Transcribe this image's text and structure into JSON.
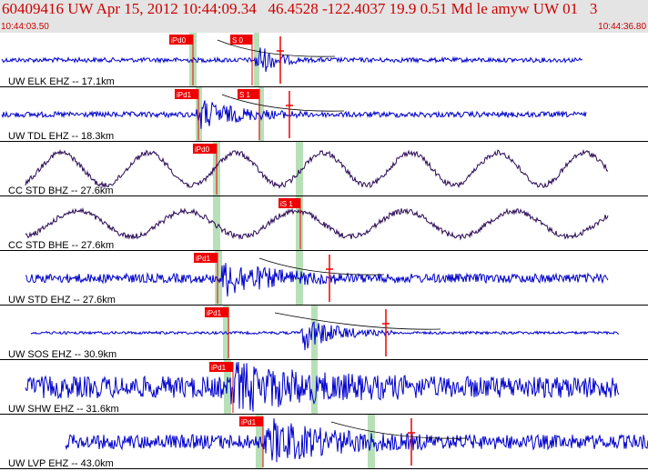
{
  "header": {
    "title": "60409416 UW Apr 15, 2012 10:44:09.34   46.4528 -122.4037 19.9 0.51 Md le amyw UW 01   3",
    "start_time": "10:44:03.50",
    "end_time": "10:44:36.80"
  },
  "colors": {
    "header_bg": "#e4e4e4",
    "header_text": "#cc0000",
    "trace_blue": "#0000cc",
    "trace_dark": "#2a0a55",
    "pick_red": "#ee0000",
    "window_green": "#b8e0b8"
  },
  "traces": [
    {
      "label": "UW ELK EHZ -- 17.1km",
      "color": "blue",
      "p_pick": "iPd0",
      "s_pick": "S 0"
    },
    {
      "label": "UW TDL EHZ -- 18.3km",
      "color": "blue",
      "p_pick": "iPd1",
      "s_pick": "S 1"
    },
    {
      "label": "CC STD BHZ -- 27.6km",
      "color": "dark",
      "p_pick": "iPd0",
      "s_pick": ""
    },
    {
      "label": "CC STD BHE -- 27.6km",
      "color": "dark",
      "p_pick": "",
      "s_pick": "iS 1"
    },
    {
      "label": "UW STD EHZ -- 27.6km",
      "color": "blue",
      "p_pick": "iPd1",
      "s_pick": ""
    },
    {
      "label": "UW SOS EHZ -- 30.9km",
      "color": "blue",
      "p_pick": "iPd1",
      "s_pick": ""
    },
    {
      "label": "UW SHW EHZ -- 31.6km",
      "color": "blue",
      "p_pick": "iPd1",
      "s_pick": ""
    },
    {
      "label": "UW LVP EHZ -- 43.0km",
      "color": "blue",
      "p_pick": "iPd1",
      "s_pick": ""
    }
  ]
}
